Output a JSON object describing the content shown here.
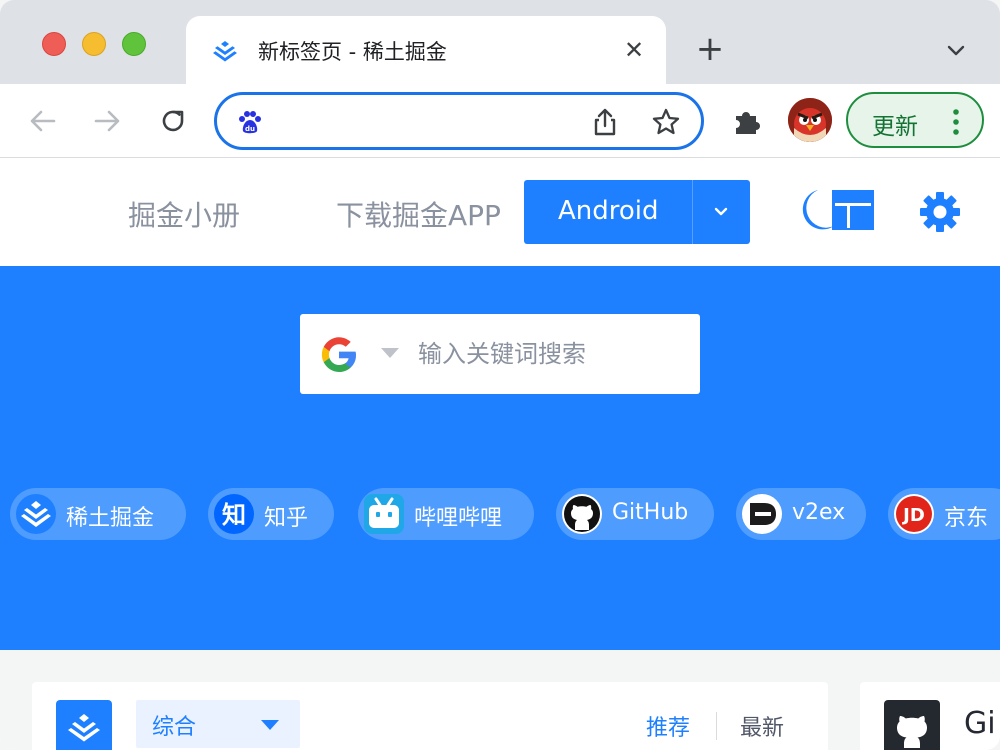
{
  "browser": {
    "tab_title": "新标签页 - 稀土掘金",
    "close_glyph": "✕",
    "new_tab_glyph": "+",
    "update_label": "更新"
  },
  "omnibox": {
    "value": "",
    "placeholder": ""
  },
  "nav": {
    "book_label": "掘金小册",
    "app_label": "下载掘金APP",
    "platform_label": "Android"
  },
  "search": {
    "placeholder": "输入关键词搜索"
  },
  "shortcuts": [
    {
      "label": "稀土掘金",
      "icon": "juejin-icon"
    },
    {
      "label": "知乎",
      "icon": "zhihu-icon"
    },
    {
      "label": "哔哩哔哩",
      "icon": "bilibili-icon"
    },
    {
      "label": "GitHub",
      "icon": "github-icon"
    },
    {
      "label": "v2ex",
      "icon": "v2ex-icon"
    },
    {
      "label": "京东",
      "icon": "jd-icon"
    }
  ],
  "feed": {
    "category": "综合",
    "tab_recommend": "推荐",
    "tab_latest": "最新",
    "side_title": "Gi"
  },
  "colors": {
    "brand": "#1e80ff",
    "update_green": "#1e8e3e"
  }
}
